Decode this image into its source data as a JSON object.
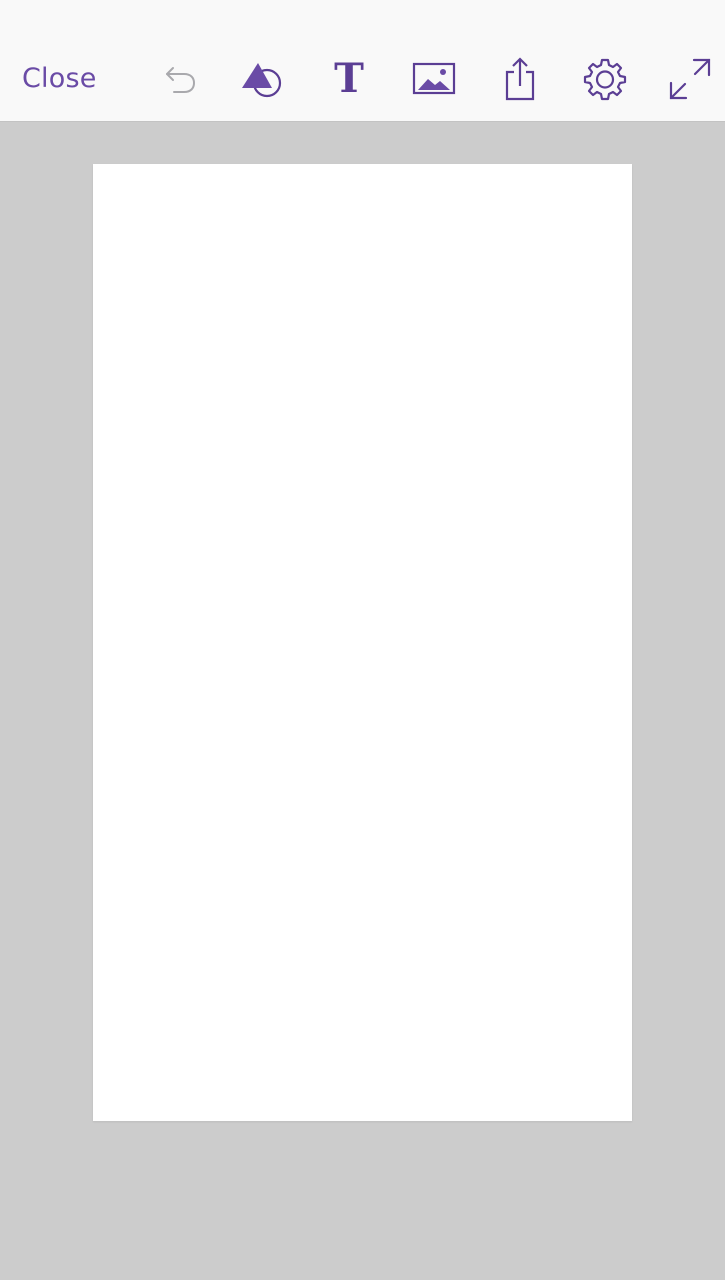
{
  "toolbar": {
    "close_label": "Close",
    "text_tool_glyph": "T",
    "icons": {
      "undo": "undo-icon",
      "shapes": "shapes-icon",
      "text": "text-icon",
      "image": "image-icon",
      "share": "share-icon",
      "settings": "gear-icon",
      "expand": "expand-icon"
    }
  },
  "colors": {
    "accent": "#6a4ba6",
    "icon": "#5b3e94",
    "disabled_icon": "#a9a9ad",
    "toolbar_bg": "#f9f9f9",
    "workspace_bg": "#cccccc",
    "artboard_bg": "#ffffff"
  }
}
